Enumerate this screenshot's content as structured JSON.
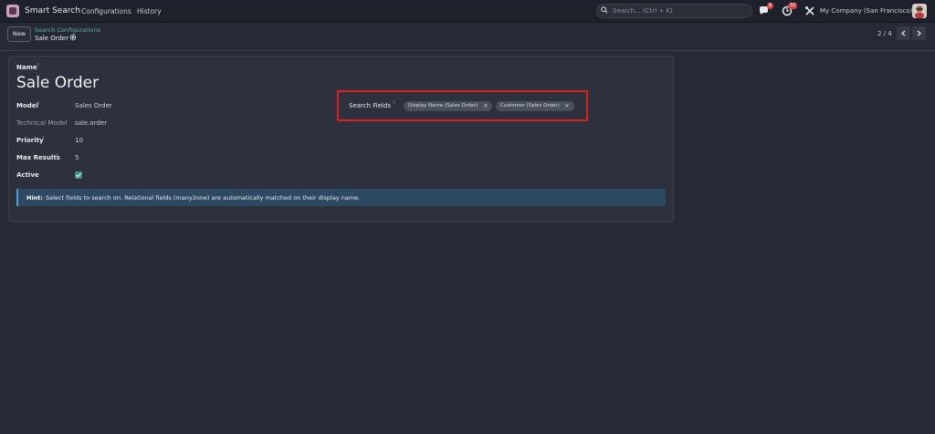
{
  "navbar": {
    "app_name": "Smart Search",
    "menu": [
      "Configurations",
      "History"
    ],
    "search_placeholder": "Search... (Ctrl + K)",
    "messages_count": "6",
    "activities_count": "32",
    "company": "My Company (San Francisco)"
  },
  "control": {
    "new_label": "New",
    "breadcrumb_parent": "Search Configurations",
    "breadcrumb_current": "Sale Order",
    "pager_value": "2 / 4"
  },
  "form": {
    "name_label": "Name",
    "name_value": "Sale Order",
    "fields": [
      {
        "label": "Model",
        "value": "Sales Order",
        "tip": "?"
      },
      {
        "label": "Technical Model",
        "value": "sale.order"
      },
      {
        "label": "Priority",
        "value": "10",
        "tip": "?"
      },
      {
        "label": "Max Results",
        "value": "5",
        "tip": "?"
      },
      {
        "label": "Active",
        "checked": true
      }
    ],
    "hint_bold": "Hint:",
    "hint_text": "Select fields to search on. Relational fields (many2one) are automatically matched on their display name.",
    "search_fields_label": "Search Fields",
    "search_fields_tags": [
      "Display Name (Sales Order)",
      "Customer (Sales Order)"
    ]
  },
  "tip_mark": "?",
  "remove_mark": "×"
}
